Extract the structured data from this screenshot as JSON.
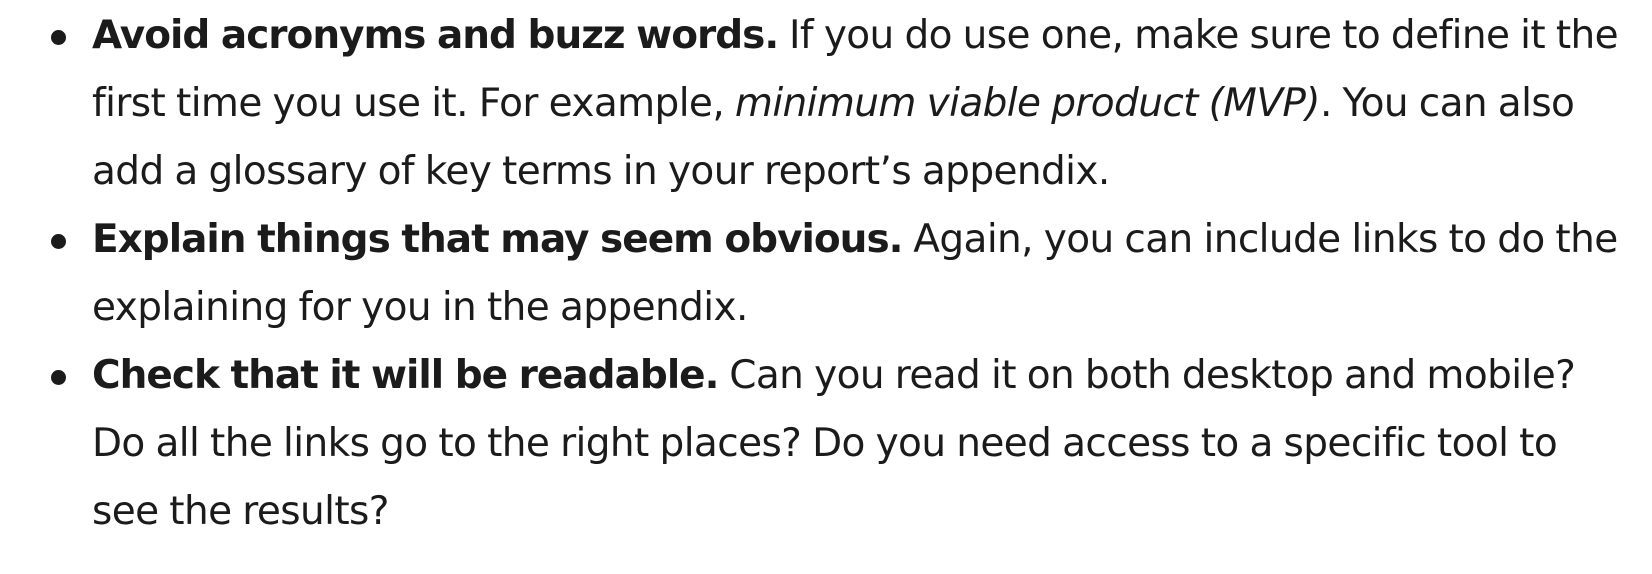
{
  "list": {
    "items": [
      {
        "lead": "Avoid acronyms and buzz words.",
        "text_before": " If you do use one, make sure to define it the first time you use it. For example, ",
        "emphasis": "minimum viable product (MVP)",
        "text_after": ". You can also add a glossary of key terms in your report’s appendix."
      },
      {
        "lead": "Explain things that may seem obvious.",
        "text": " Again, you can include links to do the explaining for you in the appendix."
      },
      {
        "lead": "Check that it will be readable.",
        "text": " Can you read it on both desktop and mobile? Do all the links go to the right places? Do you need access to a specific tool to see the results?"
      }
    ]
  }
}
